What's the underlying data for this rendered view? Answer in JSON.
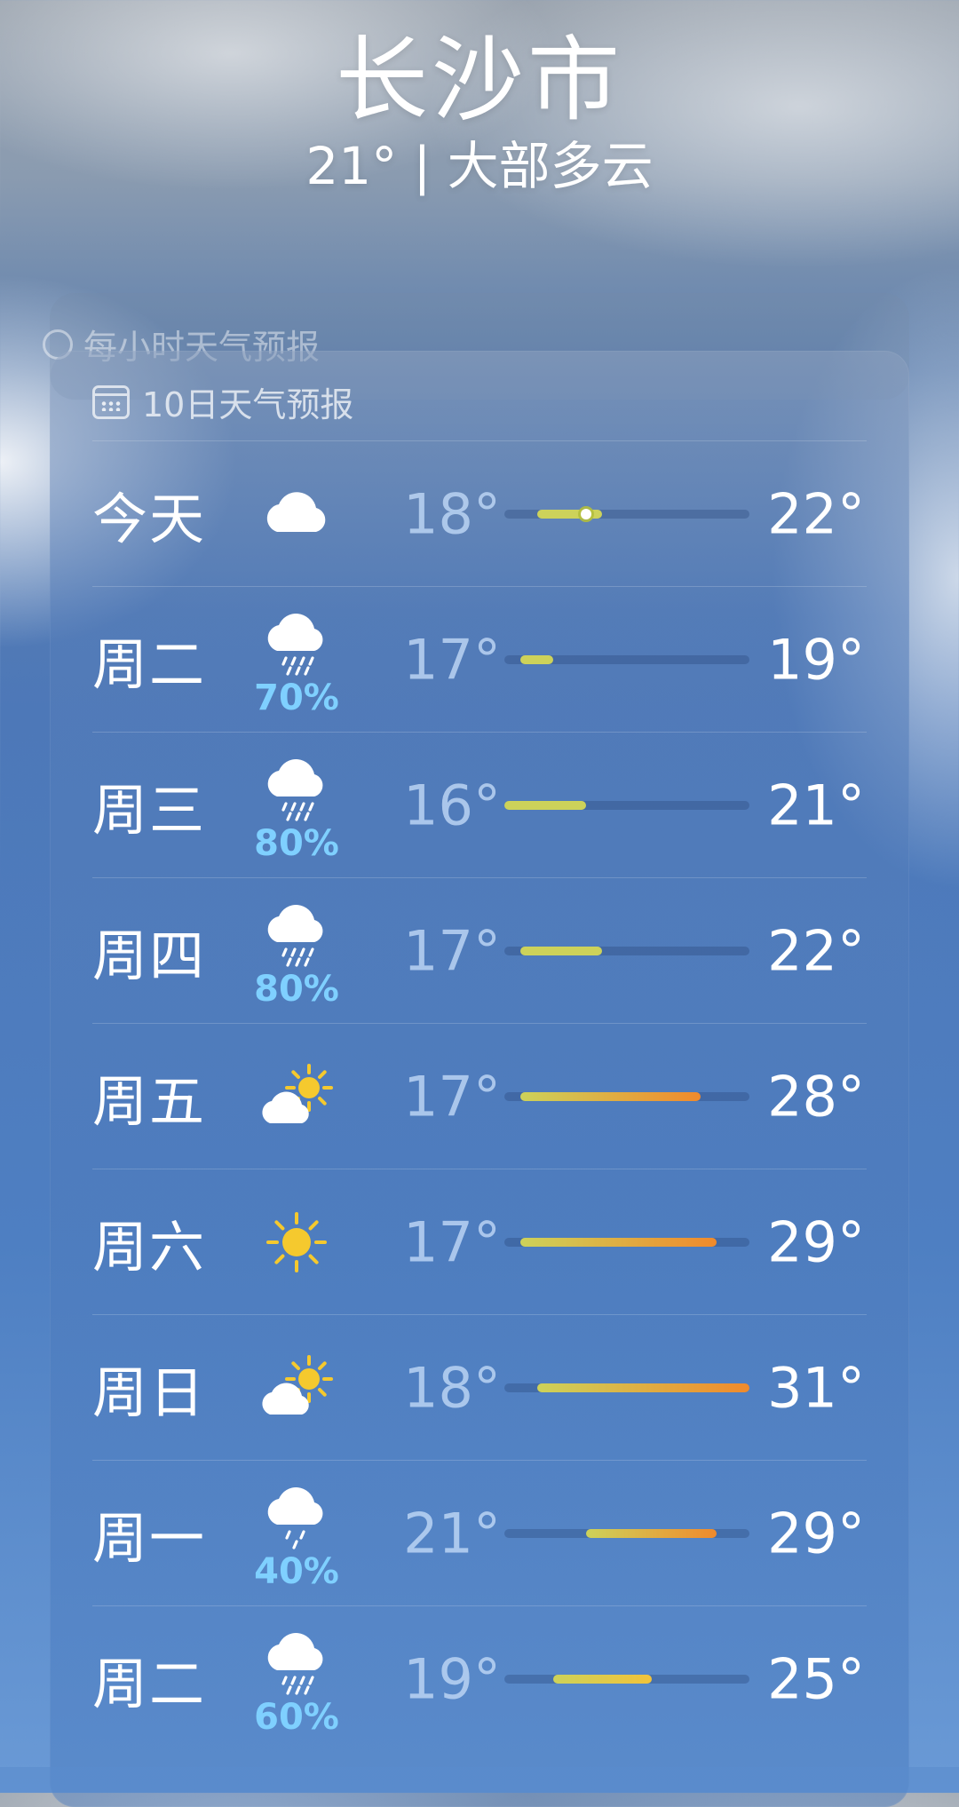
{
  "header": {
    "city": "长沙市",
    "summary": "21° | 大部多云"
  },
  "hourly": {
    "label": "每小时天气预报",
    "icon": "clock-icon"
  },
  "forecast": {
    "label": "10日天气预报",
    "icon": "calendar-icon",
    "range_min": 16,
    "range_max": 31,
    "current_temp": 21,
    "days": [
      {
        "day": "今天",
        "icon": "cloud",
        "precip": "",
        "low": "18°",
        "high": "22°",
        "lo": 18,
        "hi": 22
      },
      {
        "day": "周二",
        "icon": "cloud-rain",
        "precip": "70%",
        "low": "17°",
        "high": "19°",
        "lo": 17,
        "hi": 19
      },
      {
        "day": "周三",
        "icon": "cloud-rain",
        "precip": "80%",
        "low": "16°",
        "high": "21°",
        "lo": 16,
        "hi": 21
      },
      {
        "day": "周四",
        "icon": "cloud-rain",
        "precip": "80%",
        "low": "17°",
        "high": "22°",
        "lo": 17,
        "hi": 22
      },
      {
        "day": "周五",
        "icon": "partly-sunny",
        "precip": "",
        "low": "17°",
        "high": "28°",
        "lo": 17,
        "hi": 28
      },
      {
        "day": "周六",
        "icon": "sun",
        "precip": "",
        "low": "17°",
        "high": "29°",
        "lo": 17,
        "hi": 29
      },
      {
        "day": "周日",
        "icon": "partly-sunny",
        "precip": "",
        "low": "18°",
        "high": "31°",
        "lo": 18,
        "hi": 31
      },
      {
        "day": "周一",
        "icon": "cloud-drizzle",
        "precip": "40%",
        "low": "21°",
        "high": "29°",
        "lo": 21,
        "hi": 29
      },
      {
        "day": "周二",
        "icon": "cloud-rain",
        "precip": "60%",
        "low": "19°",
        "high": "25°",
        "lo": 19,
        "hi": 25
      }
    ]
  },
  "colors": {
    "cool": "#cdd25a",
    "mid": "#f2c33a",
    "warm": "#f08a2c",
    "precip": "#7fd0ff"
  }
}
